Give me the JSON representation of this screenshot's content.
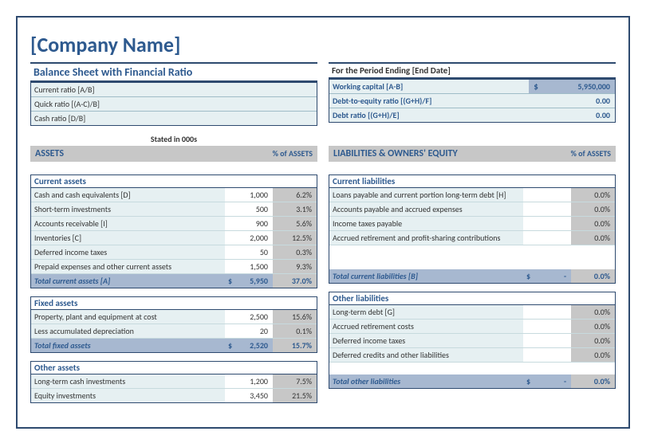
{
  "company": "[Company Name]",
  "title": "Balance Sheet with Financial Ratio",
  "period": "For the Period Ending [End Date]",
  "stated": "Stated in 000s",
  "left_ratios": [
    {
      "label": "Current ratio  [A/B]",
      "value": ""
    },
    {
      "label": "Quick ratio  [(A-C)/B]",
      "value": ""
    },
    {
      "label": "Cash ratio  [D/B]",
      "value": ""
    }
  ],
  "right_ratios": [
    {
      "label": "Working capital  [A-B]",
      "currency": "$",
      "value": "5,950,000"
    },
    {
      "label": "Debt-to-equity ratio  [(G+H)/F]",
      "value": "0.00"
    },
    {
      "label": "Debt ratio  [(G+H)/E]",
      "value": "0.00"
    }
  ],
  "hdr_assets": "ASSETS",
  "hdr_liab": "LIABILITIES & OWNERS' EQUITY",
  "hdr_pct": "% of ASSETS",
  "current_assets": {
    "title": "Current assets",
    "rows": [
      {
        "label": "Cash and cash equivalents  [D]",
        "num": "1,000",
        "pct": "6.2%"
      },
      {
        "label": "Short-term investments",
        "num": "500",
        "pct": "3.1%"
      },
      {
        "label": "Accounts receivable  [I]",
        "num": "900",
        "pct": "5.6%"
      },
      {
        "label": "Inventories  [C]",
        "num": "2,000",
        "pct": "12.5%"
      },
      {
        "label": "Deferred income taxes",
        "num": "50",
        "pct": "0.3%"
      },
      {
        "label": "Prepaid expenses and other current assets",
        "num": "1,500",
        "pct": "9.3%"
      }
    ],
    "total": {
      "label": "Total current assets  [A]",
      "num": "5,950",
      "pct": "37.0%"
    }
  },
  "fixed_assets": {
    "title": "Fixed assets",
    "rows": [
      {
        "label": "Property, plant and equipment at cost",
        "num": "2,500",
        "pct": "15.6%"
      },
      {
        "label": "Less accumulated depreciation",
        "num": "20",
        "pct": "0.1%"
      }
    ],
    "total": {
      "label": "Total fixed assets",
      "num": "2,520",
      "pct": "15.7%"
    }
  },
  "other_assets": {
    "title": "Other assets",
    "rows": [
      {
        "label": "Long-term cash investments",
        "num": "1,200",
        "pct": "7.5%"
      },
      {
        "label": "Equity investments",
        "num": "3,450",
        "pct": "21.5%"
      }
    ]
  },
  "current_liab": {
    "title": "Current liabilities",
    "rows": [
      {
        "label": "Loans payable and current portion long-term debt  [H]",
        "pct": "0.0%"
      },
      {
        "label": "Accounts payable and accrued expenses",
        "pct": "0.0%"
      },
      {
        "label": "Income taxes payable",
        "pct": "0.0%"
      },
      {
        "label": "Accrued retirement and profit-sharing contributions",
        "pct": "0.0%"
      }
    ],
    "total": {
      "label": "Total current liabilities  [B]",
      "num": "-",
      "pct": "0.0%"
    }
  },
  "other_liab": {
    "title": "Other liabilities",
    "rows": [
      {
        "label": "Long-term debt  [G]",
        "pct": "0.0%"
      },
      {
        "label": "Accrued retirement costs",
        "pct": "0.0%"
      },
      {
        "label": "Deferred income taxes",
        "pct": "0.0%"
      },
      {
        "label": "Deferred credits and other liabilities",
        "pct": "0.0%"
      }
    ],
    "total": {
      "label": "Total other liabilities",
      "num": "-",
      "pct": "0.0%"
    }
  },
  "chart_data": {
    "type": "table",
    "title": "Balance Sheet with Financial Ratio",
    "sections": {
      "current_assets": [
        {
          "label": "Cash and cash equivalents",
          "value": 1000,
          "pct": 6.2
        },
        {
          "label": "Short-term investments",
          "value": 500,
          "pct": 3.1
        },
        {
          "label": "Accounts receivable",
          "value": 900,
          "pct": 5.6
        },
        {
          "label": "Inventories",
          "value": 2000,
          "pct": 12.5
        },
        {
          "label": "Deferred income taxes",
          "value": 50,
          "pct": 0.3
        },
        {
          "label": "Prepaid expenses and other current assets",
          "value": 1500,
          "pct": 9.3
        }
      ],
      "total_current_assets": {
        "value": 5950,
        "pct": 37.0
      },
      "fixed_assets": [
        {
          "label": "Property, plant and equipment at cost",
          "value": 2500,
          "pct": 15.6
        },
        {
          "label": "Less accumulated depreciation",
          "value": 20,
          "pct": 0.1
        }
      ],
      "total_fixed_assets": {
        "value": 2520,
        "pct": 15.7
      },
      "other_assets": [
        {
          "label": "Long-term cash investments",
          "value": 1200,
          "pct": 7.5
        },
        {
          "label": "Equity investments",
          "value": 3450,
          "pct": 21.5
        }
      ],
      "working_capital": 5950000,
      "debt_to_equity": 0.0,
      "debt_ratio": 0.0
    }
  }
}
